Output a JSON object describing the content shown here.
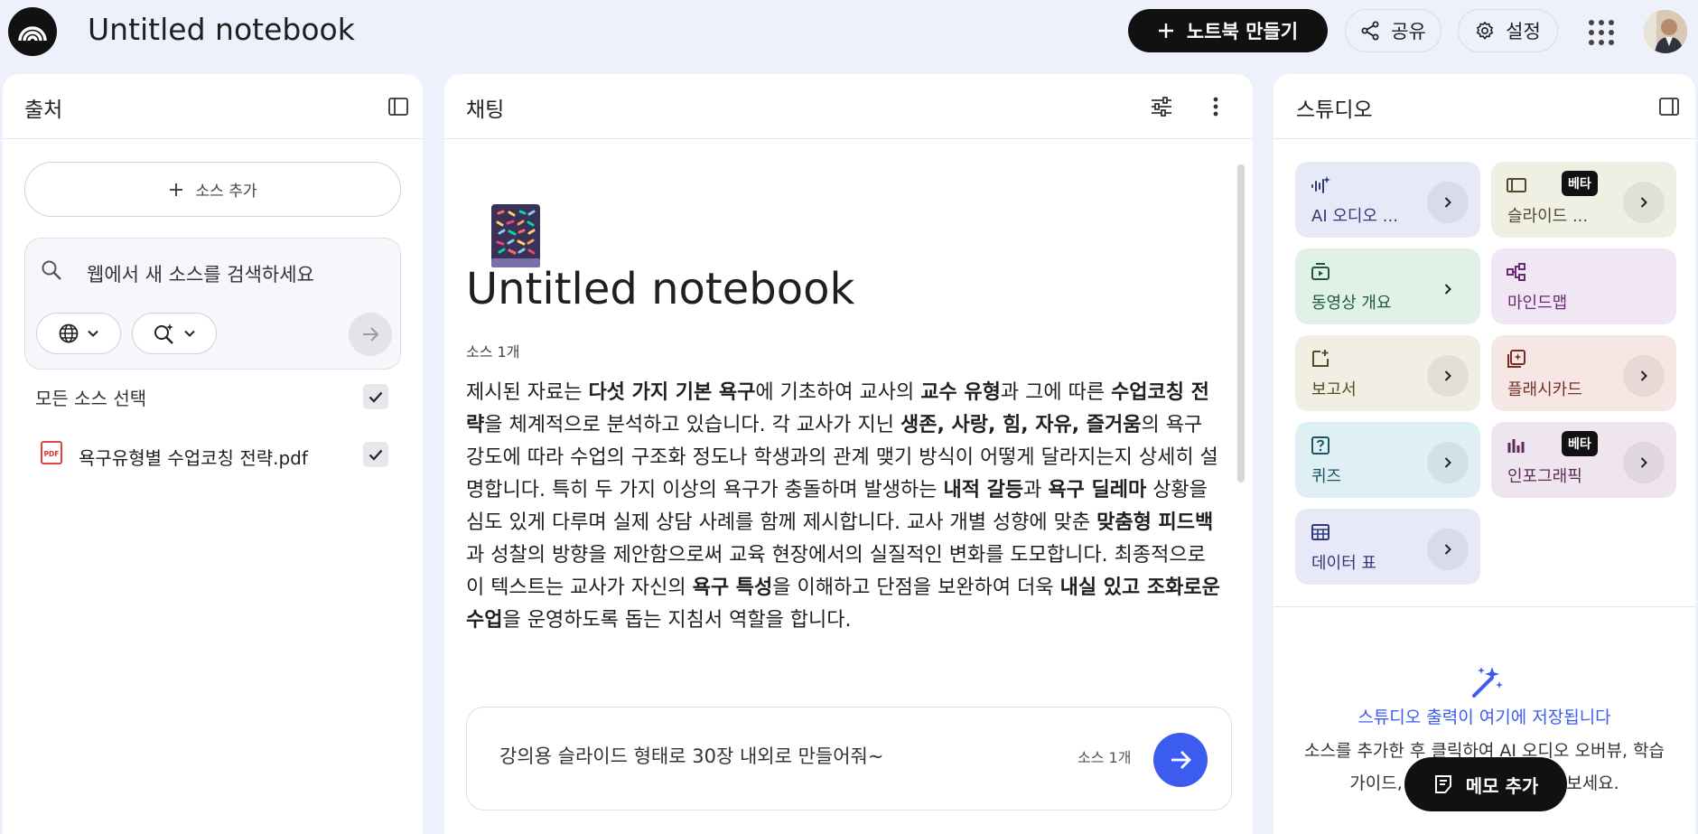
{
  "header": {
    "title": "Untitled notebook",
    "new_notebook_label": "노트북 만들기",
    "share_label": "공유",
    "settings_label": "설정"
  },
  "sources": {
    "title": "출처",
    "add_source_label": "소스 추가",
    "search_placeholder": "웹에서 새 소스를 검색하세요",
    "select_all_label": "모든 소스 선택",
    "select_all_checked": true,
    "items": [
      {
        "label": "욕구유형별 수업코칭 전략.pdf",
        "type": "PDF",
        "checked": true
      }
    ]
  },
  "chat": {
    "title": "채팅",
    "notebook_title": "Untitled notebook",
    "source_count": "소스 1개",
    "summary_segments": [
      {
        "t": "제시된 자료는 ",
        "b": false
      },
      {
        "t": "다섯 가지 기본 욕구",
        "b": true
      },
      {
        "t": "에 기초하여 교사의 ",
        "b": false
      },
      {
        "t": "교수 유형",
        "b": true
      },
      {
        "t": "과 그에 따른 ",
        "b": false
      },
      {
        "t": "수업코칭 전략",
        "b": true
      },
      {
        "t": "을 체계적으로 분석하고 있습니다. 각 교사가 지닌 ",
        "b": false
      },
      {
        "t": "생존, 사랑, 힘, 자유, 즐거움",
        "b": true
      },
      {
        "t": "의 욕구 강도에 따라 수업의 구조화 정도나 학생과의 관계 맺기 방식이 어떻게 달라지는지 상세히 설명합니다. 특히 두 가지 이상의 욕구가 충돌하며 발생하는 ",
        "b": false
      },
      {
        "t": "내적 갈등",
        "b": true
      },
      {
        "t": "과 ",
        "b": false
      },
      {
        "t": "욕구 딜레마",
        "b": true
      },
      {
        "t": " 상황을 심도 있게 다루며 실제 상담 사례를 함께 제시합니다. 교사 개별 성향에 맞춘 ",
        "b": false
      },
      {
        "t": "맞춤형 피드백",
        "b": true
      },
      {
        "t": "과 성찰의 방향을 제안함으로써 교육 현장에서의 실질적인 변화를 도모합니다. 최종적으로 이 텍스트는 교사가 자신의 ",
        "b": false
      },
      {
        "t": "욕구 특성",
        "b": true
      },
      {
        "t": "을 이해하고 단점을 보완하여 더욱 ",
        "b": false
      },
      {
        "t": "내실 있고 조화로운 수업",
        "b": true
      },
      {
        "t": "을 운영하도록 돕는 지침서 역할을 합니다.",
        "b": false
      }
    ],
    "input_value": "강의용 슬라이드 형태로 30장 내외로 만들어줘~",
    "input_source_count": "소스 1개"
  },
  "studio": {
    "title": "스튜디오",
    "tiles": [
      {
        "label": "AI 오디오 ...",
        "icon": "audio-waveform-icon",
        "bg": "#e7e9f8",
        "fg": "#2f3a7a",
        "arrow": true,
        "beta": false
      },
      {
        "label": "슬라이드 ...",
        "icon": "slides-icon",
        "bg": "#efefe4",
        "fg": "#4e4a2b",
        "arrow": true,
        "beta": true,
        "beta_label": "베타"
      },
      {
        "label": "동영상 개요",
        "icon": "video-overview-icon",
        "bg": "#e0f2e7",
        "fg": "#1f5a37",
        "arrow": true,
        "beta": false
      },
      {
        "label": "마인드맵",
        "icon": "mindmap-icon",
        "bg": "#f1e6f3",
        "fg": "#6a2c74",
        "arrow": false,
        "beta": false
      },
      {
        "label": "보고서",
        "icon": "report-icon",
        "bg": "#f1eee3",
        "fg": "#5a4a1f",
        "arrow": true,
        "beta": false
      },
      {
        "label": "플래시카드",
        "icon": "flashcard-icon",
        "bg": "#f6e7e4",
        "fg": "#7a2d24",
        "arrow": true,
        "beta": false
      },
      {
        "label": "퀴즈",
        "icon": "quiz-icon",
        "bg": "#dff0f5",
        "fg": "#1d5566",
        "arrow": true,
        "beta": false
      },
      {
        "label": "인포그래픽",
        "icon": "infographic-icon",
        "bg": "#efe5ee",
        "fg": "#5f2a5a",
        "arrow": true,
        "beta": true,
        "beta_label": "베타"
      },
      {
        "label": "데이터 표",
        "icon": "data-table-icon",
        "bg": "#e7e9f8",
        "fg": "#2f3a7a",
        "arrow": true,
        "beta": false
      }
    ],
    "empty_title": "스튜디오 출력이 여기에 저장됩니다",
    "empty_desc": "소스를 추가한 후 클릭하여 AI 오디오 오버뷰, 학습 가이드, 마인드맵 등을 추가해 보세요.",
    "add_memo_label": "메모 추가"
  },
  "colors": {
    "background": "#eef0fb",
    "accent": "#3c5cf0",
    "primary_button": "#111111",
    "pdf_red": "#d93025"
  }
}
